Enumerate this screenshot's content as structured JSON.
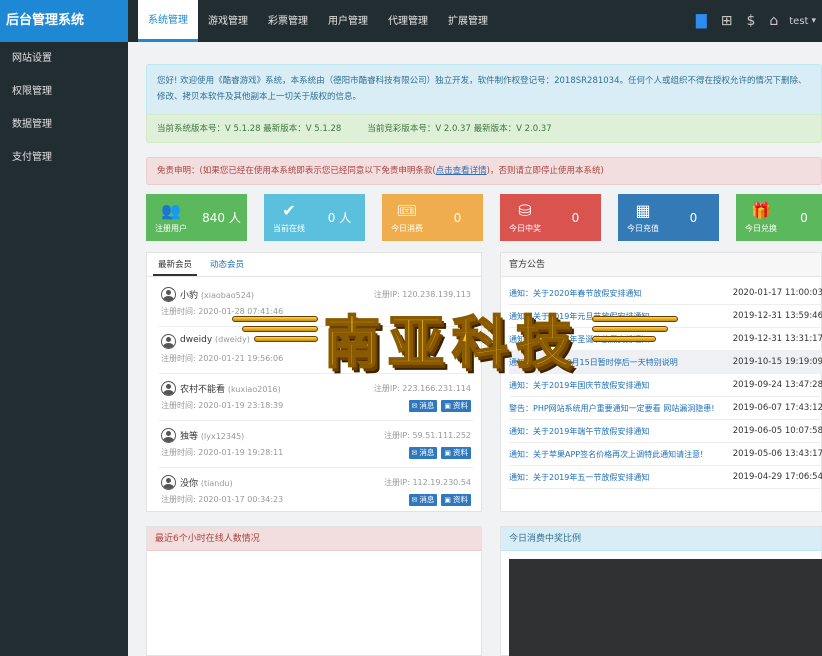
{
  "app": {
    "logo": "后台管理系统"
  },
  "topnav": {
    "tabs": [
      "系统管理",
      "游戏管理",
      "彩票管理",
      "用户管理",
      "代理管理",
      "扩展管理"
    ],
    "icons": {
      "monitor": "monitor-icon",
      "sitemap": "sitemap-icon",
      "dollar": "$",
      "home": "home-icon"
    },
    "user": "test"
  },
  "sidebar": {
    "items": [
      "网站设置",
      "权限管理",
      "数据管理",
      "支付管理"
    ]
  },
  "alerts": {
    "info": "您好! 欢迎使用《酷睿游戏》系统，本系统由（德阳市酷睿科技有限公司）独立开发，软件制作权登记号：2018SR281034。任何个人或组织不得在授权允许的情况下删除、修改、拷贝本软件及其他副本上一切关于版权的信息。",
    "version_system": "当前系统版本号：V 5.1.28 最新版本：V 5.1.28",
    "version_lottery": "当前竞彩版本号：V 2.0.37 最新版本：V 2.0.37",
    "disclaimer_prefix": "免责申明：(如果您已经在使用本系统即表示您已经同意以下免责申明条款(",
    "disclaimer_link": "点击查看详情",
    "disclaimer_suffix": ")，否则请立即停止使用本系统)"
  },
  "stats": [
    {
      "label": "注册用户",
      "value": "840 人",
      "icon": "users-icon",
      "glyph": "👥"
    },
    {
      "label": "当前在线",
      "value": "0 人",
      "icon": "user-check-icon",
      "glyph": "✔"
    },
    {
      "label": "今日消费",
      "value": "0",
      "icon": "ticket-icon",
      "glyph": "🎟"
    },
    {
      "label": "今日中奖",
      "value": "0",
      "icon": "coins-icon",
      "glyph": "⛁"
    },
    {
      "label": "今日充值",
      "value": "0",
      "icon": "calendar-icon",
      "glyph": "▦"
    },
    {
      "label": "今日兑换",
      "value": "0",
      "icon": "gift-icon",
      "glyph": "🎁"
    }
  ],
  "members": {
    "tabs": [
      "最新会员",
      "动态会员"
    ],
    "ip_prefix": "注册IP: ",
    "time_prefix": "注册时间: ",
    "msg_btn": "消息",
    "info_btn": "资料",
    "rows": [
      {
        "name": "小豹",
        "account": "(xiaobao524)",
        "time": "2020-01-28 07:41:46",
        "ip": "120.238.139.113"
      },
      {
        "name": "dweidy",
        "account": "(dweidy)",
        "time": "2020-01-21 19:56:06",
        "ip": ""
      },
      {
        "name": "农村不能看",
        "account": "(kuxiao2016)",
        "time": "2020-01-19 23:18:39",
        "ip": "223.166.231.114"
      },
      {
        "name": "独等",
        "account": "(lyx12345)",
        "time": "2020-01-19 19:28:11",
        "ip": "59.51.111.252"
      },
      {
        "name": "没你",
        "account": "(tiandu)",
        "time": "2020-01-17 00:34:23",
        "ip": "112.19.230.54"
      }
    ]
  },
  "notices": {
    "title": "官方公告",
    "rows": [
      {
        "title": "通知：关于2020年春节放假安排通知",
        "date": "2020-01-17 11:00:03"
      },
      {
        "title": "通知：关于2019年元旦节放假安排通知",
        "date": "2019-12-31 13:59:46"
      },
      {
        "title": "通知：关于2019年圣诞节放假安排通知",
        "date": "2019-12-31 13:31:17"
      },
      {
        "title": "通知：2019年10月15日暂时停后一天特别说明",
        "date": "2019-10-15 19:19:09"
      },
      {
        "title": "通知：关于2019年国庆节放假安排通知",
        "date": "2019-09-24 13:47:28"
      },
      {
        "title": "警告：PHP网站系统用户重要通知一定要看 网站漏洞隐患!",
        "date": "2019-06-07 17:43:12"
      },
      {
        "title": "通知：关于2019年端午节放假安排通知",
        "date": "2019-06-05 10:07:58"
      },
      {
        "title": "通知：关于苹果APP签名价格再次上调特此通知请注意!",
        "date": "2019-05-06 13:43:17"
      },
      {
        "title": "通知：关于2019年五一节放假安排通知",
        "date": "2019-04-29 17:06:54"
      }
    ]
  },
  "online_panel": {
    "title": "最近6个小时在线人数情况"
  },
  "ratio_panel": {
    "title": "今日消费中奖比例"
  },
  "watermark": {
    "text": "南亚科技"
  }
}
